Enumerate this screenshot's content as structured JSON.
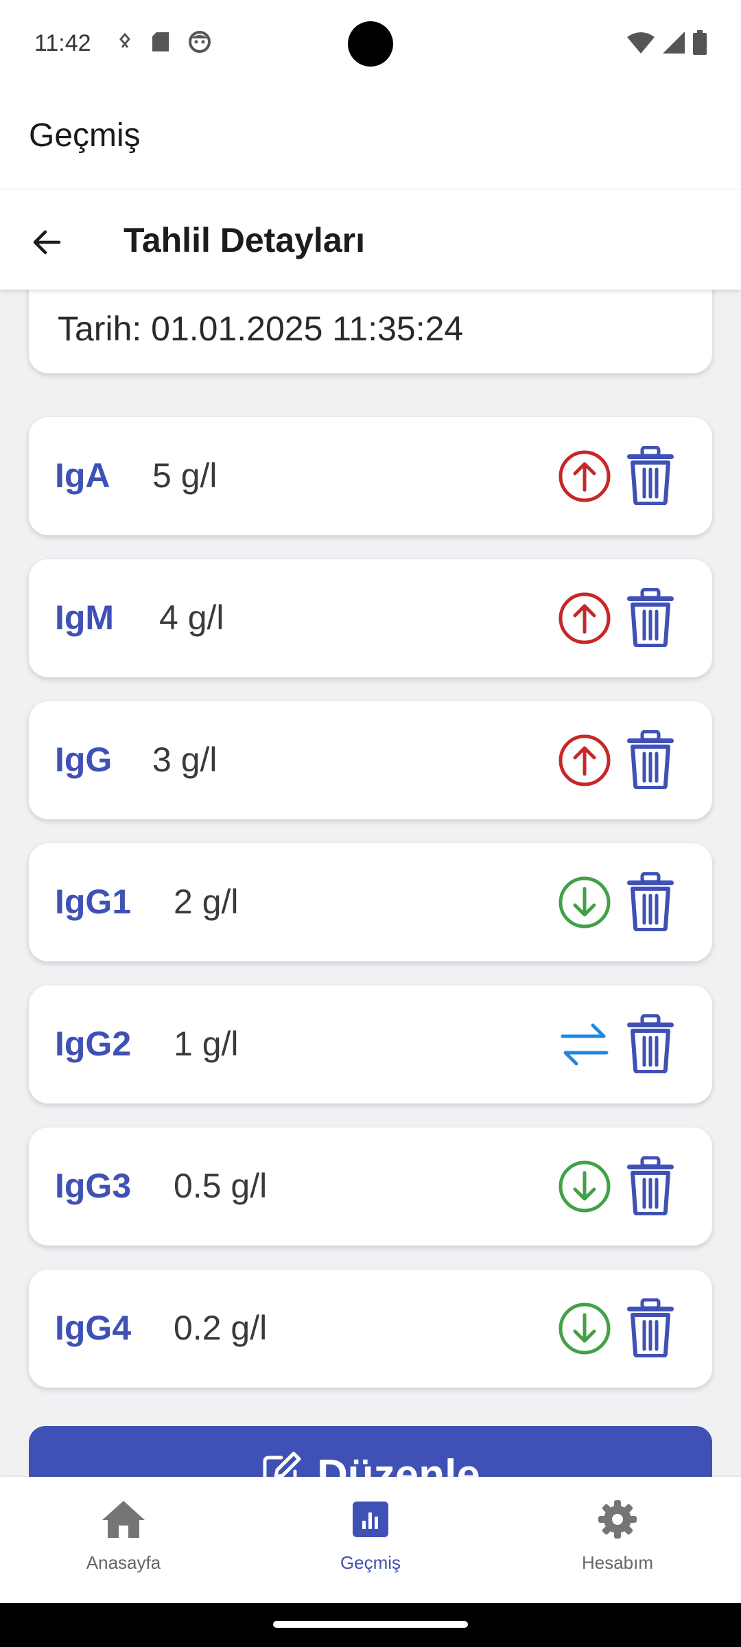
{
  "status_bar": {
    "time": "11:42",
    "left_icons": [
      "accessibility-icon",
      "sd-card-icon",
      "face-icon"
    ],
    "right_icons": [
      "wifi-icon",
      "signal-icon",
      "battery-icon"
    ]
  },
  "app_bar": {
    "title": "Geçmiş"
  },
  "sub_header": {
    "title": "Tahlil Detayları",
    "back_icon": "arrow-left-icon"
  },
  "date_card": {
    "text": "Tarih: 01.01.2025 11:35:24"
  },
  "results": [
    {
      "name": "IgA",
      "value": "5 g/l",
      "trend": "up",
      "trend_color": "#c62828"
    },
    {
      "name": "IgM",
      "value": "4 g/l",
      "trend": "up",
      "trend_color": "#c62828"
    },
    {
      "name": "IgG",
      "value": "3 g/l",
      "trend": "up",
      "trend_color": "#c62828"
    },
    {
      "name": "IgG1",
      "value": "2 g/l",
      "trend": "down",
      "trend_color": "#43a047"
    },
    {
      "name": "IgG2",
      "value": "1 g/l",
      "trend": "normal",
      "trend_color": "#1e88e5"
    },
    {
      "name": "IgG3",
      "value": "0.5 g/l",
      "trend": "down",
      "trend_color": "#43a047"
    },
    {
      "name": "IgG4",
      "value": "0.2 g/l",
      "trend": "down",
      "trend_color": "#43a047"
    }
  ],
  "edit_button": {
    "label": "Düzenle",
    "icon": "edit-icon"
  },
  "bottom_nav": {
    "items": [
      {
        "label": "Anasayfa",
        "icon": "home-icon",
        "active": false
      },
      {
        "label": "Geçmiş",
        "icon": "chart-icon",
        "active": true
      },
      {
        "label": "Hesabım",
        "icon": "settings-icon",
        "active": false
      }
    ]
  },
  "colors": {
    "primary": "#3f51b5",
    "trash": "#3f51b5",
    "up": "#c62828",
    "down": "#43a047",
    "normal": "#1e88e5"
  }
}
